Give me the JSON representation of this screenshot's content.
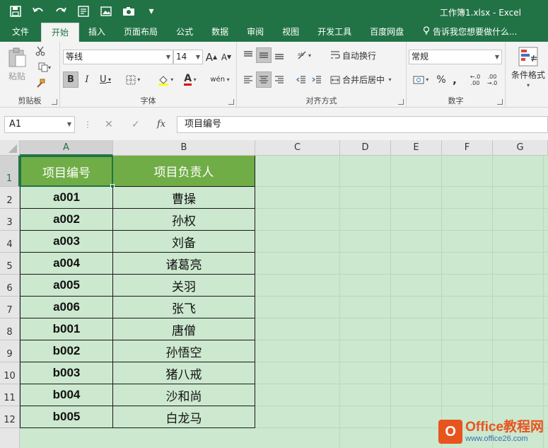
{
  "window": {
    "title": "工作簿1.xlsx - Excel"
  },
  "qat": {
    "save_icon": "save-icon",
    "undo_icon": "undo-icon",
    "redo_icon": "redo-icon",
    "more": "▾"
  },
  "tabs": [
    "文件",
    "开始",
    "插入",
    "页面布局",
    "公式",
    "数据",
    "审阅",
    "视图",
    "开发工具",
    "百度网盘"
  ],
  "active_tab": "开始",
  "tell_me": "告诉我您想要做什么...",
  "ribbon": {
    "clipboard": {
      "label": "剪贴板",
      "paste": "粘贴"
    },
    "font": {
      "label": "字体",
      "font_name": "等线",
      "font_size": "14",
      "grow": "A",
      "shrink": "A",
      "bold": "B",
      "italic": "I",
      "underline": "U",
      "wen": "wén"
    },
    "alignment": {
      "label": "对齐方式",
      "wrap": "自动换行",
      "merge": "合并后居中"
    },
    "number": {
      "label": "数字",
      "format": "常规",
      "percent": "%",
      "comma": ","
    },
    "styles": {
      "cond_format": "条件格式"
    }
  },
  "formula_bar": {
    "name_box": "A1",
    "fx": "fx",
    "content": "项目编号"
  },
  "columns": [
    "A",
    "B",
    "C",
    "D",
    "E",
    "F",
    "G"
  ],
  "rows": [
    "1",
    "2",
    "3",
    "4",
    "5",
    "6",
    "7",
    "8",
    "9",
    "10",
    "11",
    "12"
  ],
  "table": {
    "headers": [
      "项目编号",
      "项目负责人"
    ],
    "rows": [
      [
        "a001",
        "曹操"
      ],
      [
        "a002",
        "孙权"
      ],
      [
        "a003",
        "刘备"
      ],
      [
        "a004",
        "诸葛亮"
      ],
      [
        "a005",
        "关羽"
      ],
      [
        "a006",
        "张飞"
      ],
      [
        "b001",
        "唐僧"
      ],
      [
        "b002",
        "孙悟空"
      ],
      [
        "b003",
        "猪八戒"
      ],
      [
        "b004",
        "沙和尚"
      ],
      [
        "b005",
        "白龙马"
      ]
    ]
  },
  "colors": {
    "excel_green": "#217346",
    "header_fill": "#70ad47",
    "sheet_bg": "#cce8cf"
  },
  "watermark": {
    "brand": "Office教程网",
    "url": "www.office26.com"
  }
}
